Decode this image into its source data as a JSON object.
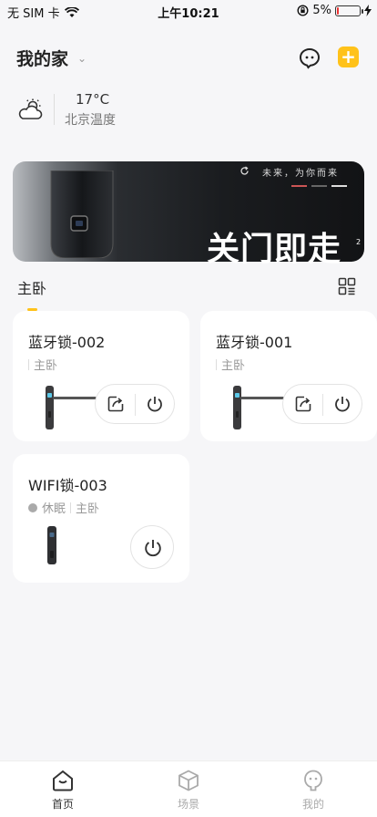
{
  "status_bar": {
    "carrier": "无 SIM 卡",
    "time": "上午10:21",
    "battery": "5%",
    "battery_level": 0.05
  },
  "header": {
    "home_name": "我的家"
  },
  "weather": {
    "temperature": "17°C",
    "label": "北京温度"
  },
  "banner": {
    "slogan": "未来，为你而来",
    "headline": "关门即走",
    "page": "2"
  },
  "room": {
    "tab_label": "主卧"
  },
  "devices": [
    {
      "name": "蓝牙锁-002",
      "status": "",
      "room": "主卧"
    },
    {
      "name": "蓝牙锁-001",
      "status": "",
      "room": "主卧"
    },
    {
      "name": "WIFI锁-003",
      "status": "休眠",
      "room": "主卧"
    }
  ],
  "tabbar": {
    "items": [
      {
        "label": "首页"
      },
      {
        "label": "场景"
      },
      {
        "label": "我的"
      }
    ]
  },
  "colors": {
    "accent": "#ffc21a",
    "background": "#f6f6f8",
    "battery_low": "#ee3333"
  }
}
